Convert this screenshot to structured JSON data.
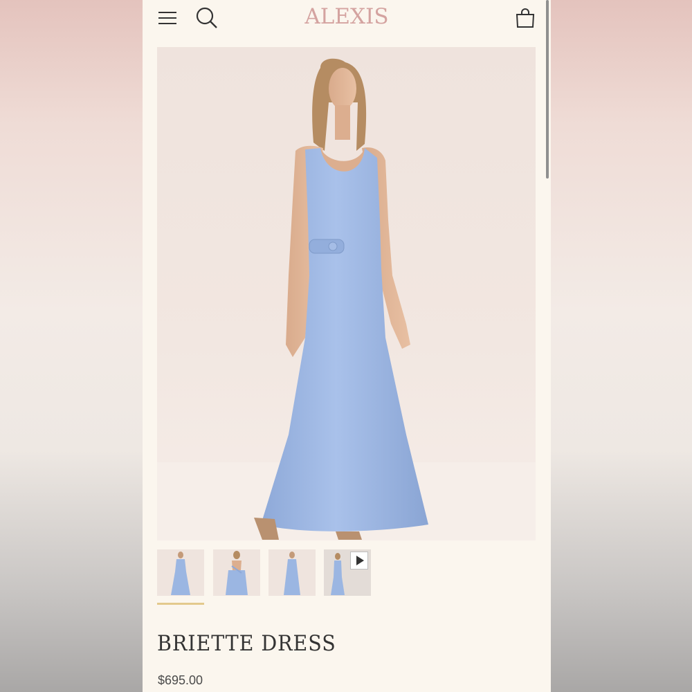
{
  "brand": {
    "name": "ALEXIS",
    "color": "#d4a3a0"
  },
  "header": {
    "menu_icon": "hamburger-menu-icon",
    "search_icon": "search-icon",
    "cart_icon": "shopping-bag-icon"
  },
  "product": {
    "title": "BRIETTE DRESS",
    "price": "$695.00",
    "dress_color": "#9bb6e2"
  },
  "gallery": {
    "thumbnails": [
      {
        "view": "front",
        "active": true
      },
      {
        "view": "back",
        "active": false
      },
      {
        "view": "front-full",
        "active": false
      },
      {
        "view": "side-video",
        "active": false,
        "icon": "play-icon"
      }
    ],
    "active_indicator_color": "#e3c98d"
  }
}
